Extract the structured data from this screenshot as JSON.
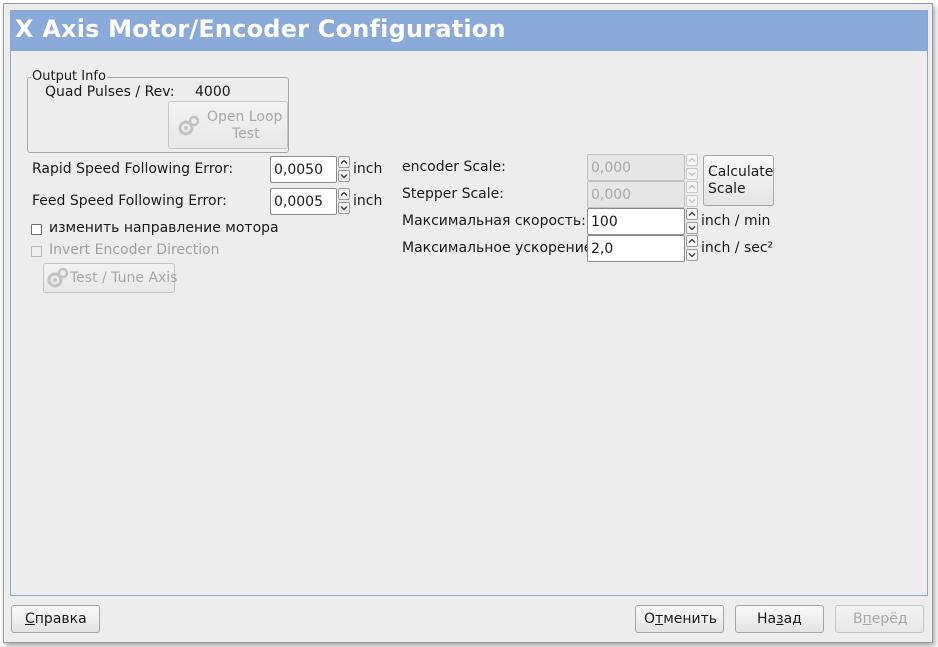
{
  "header": {
    "title": "X Axis Motor/Encoder Configuration"
  },
  "output_info": {
    "legend": "Output Info",
    "quad_pulses_label": "Quad Pulses / Rev:",
    "quad_pulses_value": "4000",
    "open_loop_button": {
      "line1": "Open Loop",
      "line2": "Test"
    }
  },
  "fields_left": {
    "rapid_label": "Rapid Speed Following Error:",
    "rapid_value": "0,0050",
    "rapid_unit": "inch",
    "feed_label": "Feed Speed Following Error:",
    "feed_value": "0,0005",
    "feed_unit": "inch"
  },
  "checkboxes": {
    "reverse_motor": "изменить направление мотора",
    "invert_encoder": "Invert Encoder Direction"
  },
  "test_tune_button": "Test / Tune Axis",
  "fields_right": {
    "encoder_scale_label": "encoder Scale:",
    "encoder_scale_value": "0,000",
    "stepper_scale_label": "Stepper Scale:",
    "stepper_scale_value": "0,000",
    "max_speed_label": "Максимальная скорость:",
    "max_speed_value": "100",
    "max_speed_unit": "inch / min",
    "max_accel_label": "Максимальное ускорение:",
    "max_accel_value": "2,0",
    "max_accel_unit": "inch / sec²"
  },
  "calculate_scale_button": {
    "line1": "Calculate",
    "line2": "Scale"
  },
  "footer": {
    "help": {
      "mnemonic": "С",
      "rest": "правка"
    },
    "cancel": {
      "before": "О",
      "mnemonic": "т",
      "rest": "менить"
    },
    "back": {
      "before": "На",
      "mnemonic": "з",
      "rest": "ад"
    },
    "forward": {
      "before": "В",
      "mnemonic": "п",
      "rest": "ерёд"
    }
  },
  "colors": {
    "header_bg": "#8aaad9",
    "window_bg": "#ededed",
    "disabled_text": "#a8a8a8"
  },
  "icons": {
    "gears": "gears-icon",
    "spin_up": "chevron-up-icon",
    "spin_down": "chevron-down-icon"
  }
}
